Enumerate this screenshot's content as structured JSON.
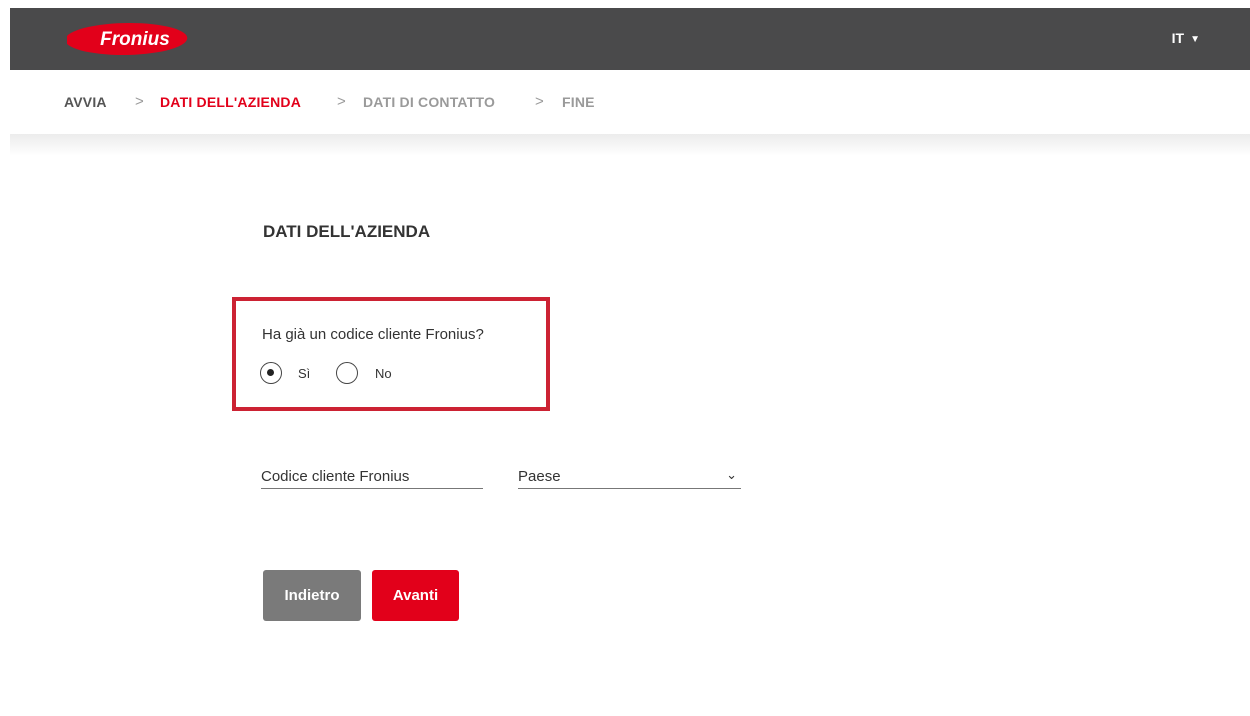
{
  "header": {
    "logo_text": "Fronius",
    "language": "IT",
    "brand_color": "#e2001a",
    "bar_color": "#4a4a4b"
  },
  "steps": {
    "items": [
      {
        "label": "AVVIA",
        "state": "done"
      },
      {
        "label": "DATI DELL'AZIENDA",
        "state": "active"
      },
      {
        "label": "DATI DI CONTATTO",
        "state": "pending"
      },
      {
        "label": "FINE",
        "state": "pending"
      }
    ],
    "separator": ">"
  },
  "form": {
    "title": "DATI DELL'AZIENDA",
    "question": "Ha già un codice cliente Fronius?",
    "options": [
      {
        "label": "Sì",
        "selected": true
      },
      {
        "label": "No",
        "selected": false
      }
    ],
    "customer_code_placeholder": "Codice cliente Fronius",
    "country_placeholder": "Paese",
    "back_label": "Indietro",
    "next_label": "Avanti"
  }
}
